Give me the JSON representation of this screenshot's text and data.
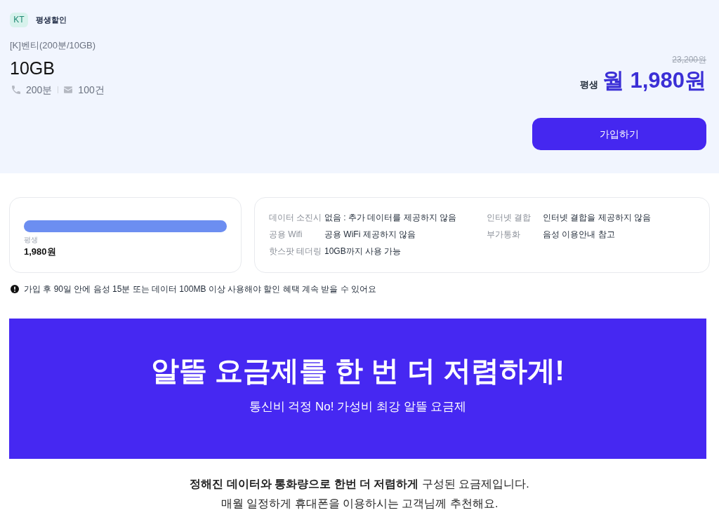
{
  "plan": {
    "carrier_badge": "KT",
    "tag": "평생할인",
    "name": "[K]벤티(200분/10GB)",
    "data": "10GB",
    "specs": [
      {
        "kind": "call",
        "text": "200분"
      },
      {
        "kind": "sms",
        "text": "100건"
      }
    ],
    "original_price": "23,200원",
    "price_label": "평생",
    "price": "월 1,980원",
    "join_button": "가입하기"
  },
  "price_timeline": {
    "level": 1,
    "period": "평생",
    "amount": "1,980원"
  },
  "details": [
    {
      "label": "데이터 소진시",
      "value": "없음 : 추가 데이터를 제공하지 않음"
    },
    {
      "label": "인터넷 결합",
      "value": "인터넷 결합을 제공하지 않음"
    },
    {
      "label": "공용 Wifi",
      "value": "공용 WiFi 제공하지 않음"
    },
    {
      "label": "부가통화",
      "value": "음성 이용안내 참고"
    },
    {
      "label": "핫스팟 테더링",
      "value": "10GB까지 사용 가능"
    }
  ],
  "notice": "가입 후 90일 안에 음성 15분 또는 데이터 100MB 이상 사용해야 할인 혜택 계속 받을 수 있어요",
  "banner": {
    "title": "알뜰 요금제를 한 번 더 저렴하게!",
    "subtitle": "통신비 걱정 No! 가성비 최강 알뜰 요금제"
  },
  "description": [
    "**정해진 데이터와 통화량으로 한번 더 저렴하게** 구성된 요금제입니다.",
    "매월 일정하게 휴대폰을 이용하시는 고객님께 추천해요."
  ]
}
